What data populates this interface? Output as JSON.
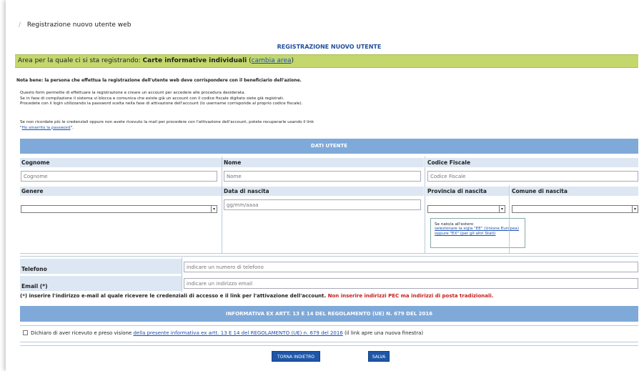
{
  "breadcrumb": {
    "separator": "/",
    "current": "Registrazione nuovo utente web"
  },
  "page_title": "REGISTRAZIONE NUOVO UTENTE",
  "area": {
    "prefix": "Area per la quale ci si sta registrando: ",
    "name": "Carte informative individuali",
    "open_paren": " (",
    "change_link": "cambia area",
    "close_paren": ")"
  },
  "note": "Nota bene: la persona che effettua la registrazione dell'utente web deve corrispondere con il beneficiario dell'azione.",
  "info_lines": [
    "Questo form permette di effettuare la registrazione e creare un account per accedere alle procedura desiderata.",
    "Se in fase di compilazione il sistema vi blocca e comunica che esiste già un account con il codice fiscale digitato siete già registrati.",
    "Procedete con il login utilizzando la password scelta nella fase di attivazione dell'account (lo username corrisponde al proprio codice fiscale)."
  ],
  "recover": {
    "text": "Se non ricordate più le credenziali oppure non avete ricevuto la mail per procedere con l'attivazione dell'account, potete recuperarle usando il link",
    "link_open": "\"",
    "link": "Ho smarrito la password",
    "link_close": "\"."
  },
  "section_user": "DATI UTENTE",
  "fields": {
    "cognome_label": "Cognome",
    "cognome_placeholder": "Cognome",
    "nome_label": "Nome",
    "nome_placeholder": "Nome",
    "cf_label": "Codice Fiscale",
    "cf_placeholder": "Codice Fiscale",
    "genere_label": "Genere",
    "genere_value": "",
    "data_label": "Data di nascita",
    "data_placeholder": "gg/mm/aaaa",
    "provincia_label": "Provincia di nascita",
    "provincia_value": "",
    "comune_label": "Comune di nascita",
    "comune_value": "",
    "telefono_label": "Telefono",
    "telefono_placeholder": "indicare un numero di telefono",
    "email_label": "Email (*)",
    "email_placeholder": "indicare un indirizzo email"
  },
  "tip": {
    "line1": "Se nato/a all'estero",
    "link": "selezionare la sigla \"EE\" (Unione Europea) oppure \"EX\" (per gli altri Stati)"
  },
  "warning": {
    "main": "(*) inserire l'indirizzo e-mail al quale ricevere le credenziali di accesso e il link per l'attivazione dell'account.",
    "red": " Non inserire indirizzi PEC ma indirizzi di posta tradizionali."
  },
  "section_privacy": "INFORMATIVA EX ARTT. 13 E 14 DEL REGOLAMENTO (UE) N. 679 DEL 2016",
  "consent": {
    "text": "Dichiaro di aver ricevuto e preso visione ",
    "link": "della presente informativa ex artt. 13 E 14 del REGOLAMENTO (UE) n. 679 del 2016",
    "suffix": " (il link apre una nuova finestra)"
  },
  "buttons": {
    "back": "TORNA INDIETRO",
    "save": "SALVA"
  },
  "colors": {
    "green": "#c3d76c",
    "blue_header": "#7fa9d9",
    "label_bg": "#dce7f3",
    "link": "#1a4fb0",
    "title": "#1f4e9c",
    "button": "#1f56a8",
    "red": "#c81d1d"
  }
}
